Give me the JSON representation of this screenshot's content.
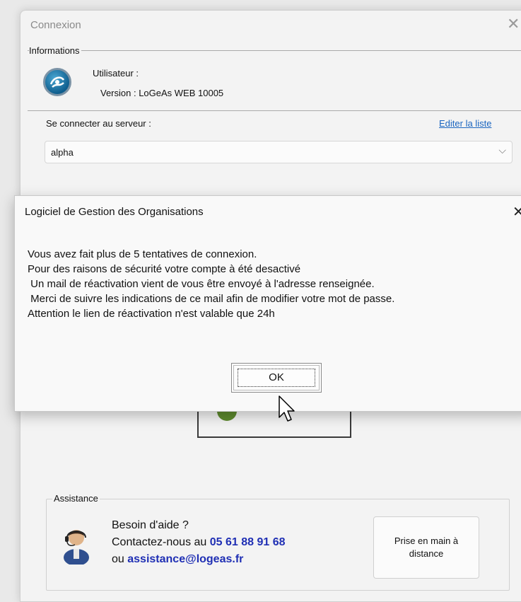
{
  "window": {
    "title": "Connexion",
    "close_glyph": "✕"
  },
  "informations": {
    "legend": "Informations",
    "user_label": "Utilisateur :",
    "version_label": "Version : LoGeAs WEB 10005",
    "logo_icon": "logeas-logo-icon"
  },
  "server": {
    "label": "Se connecter au serveur :",
    "edit_link": "Editer la liste",
    "selected": "alpha",
    "chevron": "⌵"
  },
  "assistance": {
    "legend": "Assistance",
    "help_title": "Besoin d'aide ?",
    "contact_prefix": "Contactez-nous au ",
    "phone": "05 61 88 91 68",
    "or_prefix": "ou ",
    "email": "assistance@logeas.fr",
    "remote_button": "Prise en main à distance",
    "avatar_icon": "support-agent-icon"
  },
  "dialog": {
    "title": "Logiciel de Gestion des Organisations",
    "close_glyph": "✕",
    "message_lines": [
      "Vous avez fait plus de 5 tentatives de connexion.",
      "Pour des raisons de sécurité votre compte à été desactivé",
      " Un mail de réactivation vient de vous être envoyé à l'adresse renseignée.",
      " Merci de suivre les indications de ce mail afin de modifier votre mot de passe.",
      "Attention le lien de réactivation n'est valable que 24h"
    ],
    "ok_button": "OK"
  },
  "colors": {
    "link": "#1a65c0",
    "contact_blue": "#1f2fb4",
    "logo_blue": "#0f5e8e"
  }
}
